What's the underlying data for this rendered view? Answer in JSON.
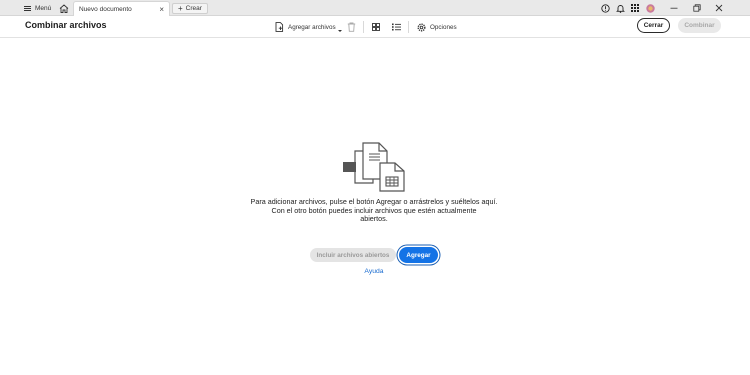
{
  "titlebar": {
    "menu_label": "Menú",
    "home_icon": "home-icon",
    "tab_title": "Nuevo documento",
    "tab_close": "×",
    "create_label": "Crear",
    "icons": [
      "help-icon",
      "bell-icon",
      "apps-grid-icon",
      "avatar"
    ],
    "window_controls": [
      "minimize-icon",
      "restore-icon",
      "close-icon"
    ]
  },
  "toolbar": {
    "title": "Combinar archivos",
    "add_files_label": "Agregar archivos",
    "options_label": "Opciones",
    "close_label": "Cerrar",
    "combine_label": "Combinar",
    "icons": [
      "add-file-icon",
      "trash-icon",
      "grid-view-icon",
      "list-view-icon",
      "gear-icon"
    ]
  },
  "main": {
    "message_line1": "Para adicionar archivos, pulse el botón Agregar o arrástrelos y suéltelos aquí.",
    "message_line2": "Con el otro botón puedes incluir archivos que estén actualmente",
    "message_line3": "abiertos.",
    "include_open_label": "Incluir archivos abiertos",
    "add_label": "Agregar",
    "help_label": "Ayuda"
  },
  "colors": {
    "accent": "#1473e6",
    "link": "#1a6cd0",
    "disabled_bg": "#e9e9e9",
    "disabled_text": "#a8a8a8"
  }
}
